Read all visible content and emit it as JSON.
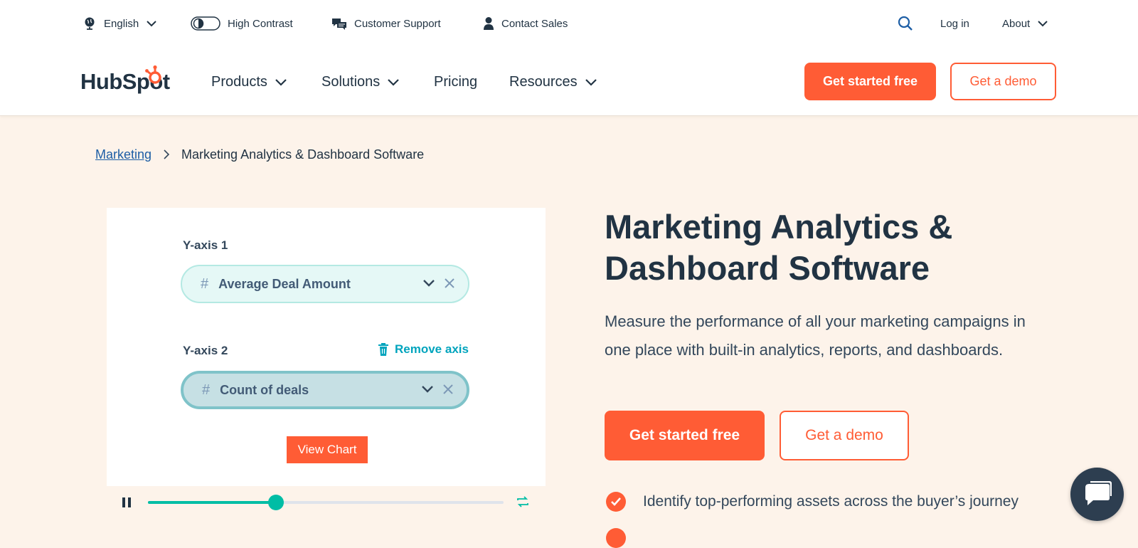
{
  "utility": {
    "language": "English",
    "high_contrast": "High Contrast",
    "customer_support": "Customer Support",
    "contact_sales": "Contact Sales",
    "login": "Log in",
    "about": "About"
  },
  "nav": {
    "logo": "HubSpot",
    "items": [
      "Products",
      "Solutions",
      "Pricing",
      "Resources"
    ],
    "cta_primary": "Get started free",
    "cta_secondary": "Get a demo"
  },
  "breadcrumb": {
    "parent": "Marketing",
    "current": "Marketing Analytics & Dashboard Software"
  },
  "media": {
    "y1_label": "Y-axis 1",
    "y1_value": "Average Deal Amount",
    "y2_label": "Y-axis 2",
    "y2_value": "Count of deals",
    "remove_axis": "Remove axis",
    "view_chart": "View Chart",
    "progress": 0.36
  },
  "hero": {
    "title": "Marketing Analytics & Dashboard Software",
    "description": "Measure the performance of all your marketing campaigns in one place with built-in analytics, reports, and dashboards.",
    "cta_primary": "Get started free",
    "cta_secondary": "Get a demo",
    "benefits": [
      "Identify top-performing assets across the buyer’s journey"
    ]
  },
  "colors": {
    "brand_orange": "#ff5c35",
    "navy": "#213343",
    "teal": "#00bda5",
    "page_bg": "#fdf3ea"
  }
}
